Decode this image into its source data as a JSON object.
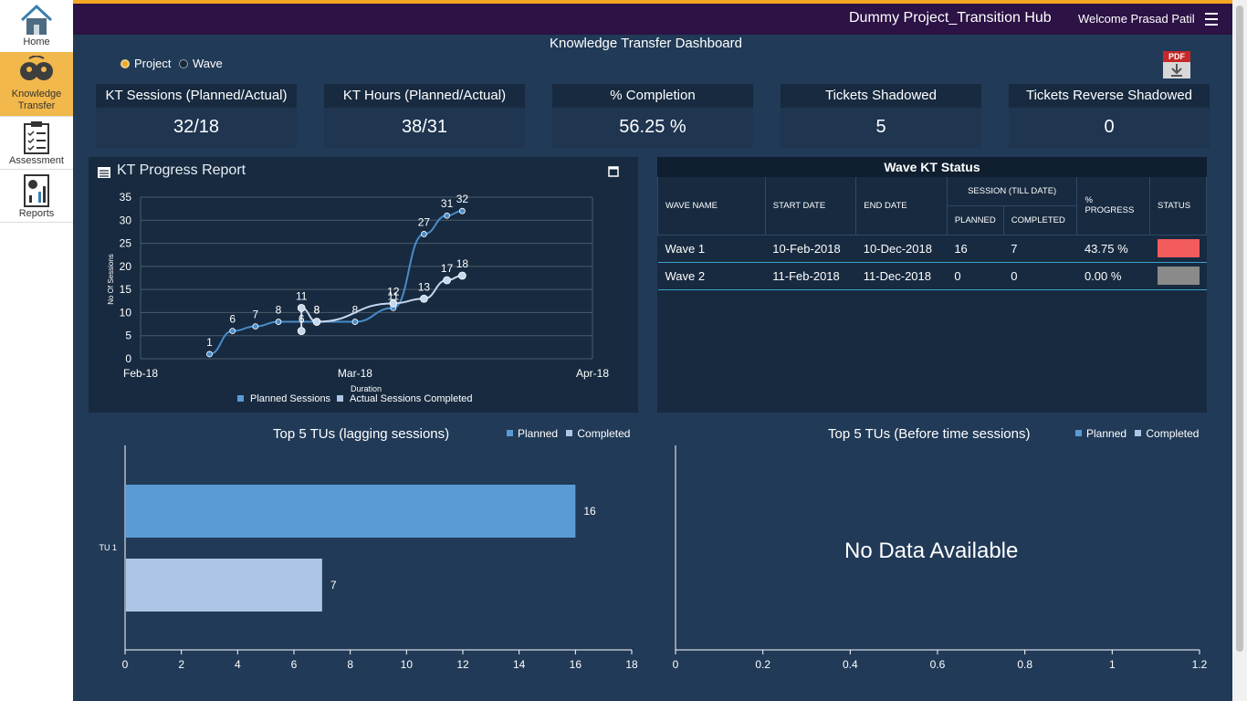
{
  "sidebar": {
    "items": [
      {
        "label": "Home",
        "icon": "home-icon"
      },
      {
        "label": "Knowledge Transfer",
        "icon": "people-icon"
      },
      {
        "label": "Assessment",
        "icon": "checklist-icon"
      },
      {
        "label": "Reports",
        "icon": "report-icon"
      }
    ]
  },
  "header": {
    "app_title": "Dummy Project_Transition Hub",
    "welcome": "Welcome Prasad Patil",
    "menu_icon": "hamburger-icon"
  },
  "dashboard": {
    "title": "Knowledge Transfer Dashboard",
    "view_options": [
      {
        "label": "Project",
        "selected": true
      },
      {
        "label": "Wave",
        "selected": false
      }
    ],
    "pdf_label": "PDF"
  },
  "kpis": [
    {
      "label": "KT Sessions  (Planned/Actual)",
      "value": "32/18"
    },
    {
      "label": "KT Hours (Planned/Actual)",
      "value": "38/31"
    },
    {
      "label": "% Completion",
      "value": "56.25 %"
    },
    {
      "label": "Tickets Shadowed",
      "value": "5"
    },
    {
      "label": "Tickets Reverse Shadowed",
      "value": "0"
    }
  ],
  "progress_report": {
    "title": "KT Progress Report"
  },
  "wave_status": {
    "title": "Wave KT Status",
    "headers": {
      "wave_name": "WAVE NAME",
      "start_date": "START DATE",
      "end_date": "END DATE",
      "session_group": "SESSION (TILL DATE)",
      "planned": "PLANNED",
      "completed": "COMPLETED",
      "progress": "% PROGRESS",
      "status": "STATUS"
    },
    "rows": [
      {
        "wave": "Wave 1",
        "start": "10-Feb-2018",
        "end": "10-Dec-2018",
        "planned": "16",
        "completed": "7",
        "progress": "43.75 %",
        "status_color": "#f25c5c"
      },
      {
        "wave": "Wave 2",
        "start": "11-Feb-2018",
        "end": "11-Dec-2018",
        "planned": "0",
        "completed": "0",
        "progress": "0.00 %",
        "status_color": "#8a8a8a"
      }
    ]
  },
  "lagging": {
    "title": "Top 5 TUs (lagging sessions)",
    "legend_planned": "Planned",
    "legend_completed": "Completed"
  },
  "before_time": {
    "title": "Top 5 TUs (Before time sessions)",
    "legend_planned": "Planned",
    "legend_completed": "Completed",
    "no_data": "No Data Available"
  },
  "colors": {
    "planned": "#5b9bd5",
    "completed": "#adc6e5",
    "line_planned": "#4a8cc8",
    "line_actual": "#c6d8ef",
    "accent": "#f5a623",
    "header": "#2c1245"
  },
  "chart_data": [
    {
      "type": "line",
      "title": "",
      "xlabel": "Duration",
      "ylabel": "No Of Sessions",
      "x_ticks": [
        "Feb-18",
        "Mar-18",
        "Apr-18"
      ],
      "x_range": [
        "2018-02-01",
        "2018-04-01"
      ],
      "ylim": [
        0,
        35
      ],
      "y_ticks": [
        0,
        5,
        10,
        15,
        20,
        25,
        30,
        35
      ],
      "grid": true,
      "legend_position": "bottom",
      "series": [
        {
          "name": "Planned Sessions",
          "points": [
            {
              "x": "2018-02-10",
              "y": 1
            },
            {
              "x": "2018-02-13",
              "y": 6
            },
            {
              "x": "2018-02-16",
              "y": 7
            },
            {
              "x": "2018-02-19",
              "y": 8
            },
            {
              "x": "2018-02-24",
              "y": 8
            },
            {
              "x": "2018-03-01",
              "y": 8
            },
            {
              "x": "2018-03-06",
              "y": 11
            },
            {
              "x": "2018-03-10",
              "y": 27
            },
            {
              "x": "2018-03-13",
              "y": 31
            },
            {
              "x": "2018-03-15",
              "y": 32
            }
          ]
        },
        {
          "name": "Actual Sessions Completed",
          "points": [
            {
              "x": "2018-02-22",
              "y": 6
            },
            {
              "x": "2018-02-22",
              "y": 11
            },
            {
              "x": "2018-02-24",
              "y": 8
            },
            {
              "x": "2018-03-06",
              "y": 12
            },
            {
              "x": "2018-03-10",
              "y": 13
            },
            {
              "x": "2018-03-13",
              "y": 17
            },
            {
              "x": "2018-03-15",
              "y": 18
            }
          ]
        }
      ]
    },
    {
      "type": "bar",
      "orientation": "horizontal",
      "title": "Top 5 TUs (lagging sessions)",
      "categories": [
        "TU 1"
      ],
      "series": [
        {
          "name": "Planned",
          "values": [
            16
          ]
        },
        {
          "name": "Completed",
          "values": [
            7
          ]
        }
      ],
      "xlim": [
        0,
        18
      ],
      "x_ticks": [
        0,
        2,
        4,
        6,
        8,
        10,
        12,
        14,
        16,
        18
      ],
      "legend_position": "top-right"
    },
    {
      "type": "bar",
      "orientation": "horizontal",
      "title": "Top 5 TUs (Before time sessions)",
      "categories": [],
      "series": [
        {
          "name": "Planned",
          "values": []
        },
        {
          "name": "Completed",
          "values": []
        }
      ],
      "xlim": [
        0,
        1.2
      ],
      "x_ticks": [
        0,
        0.2,
        0.4,
        0.6,
        0.8,
        1,
        1.2
      ],
      "legend_position": "top-right"
    }
  ]
}
